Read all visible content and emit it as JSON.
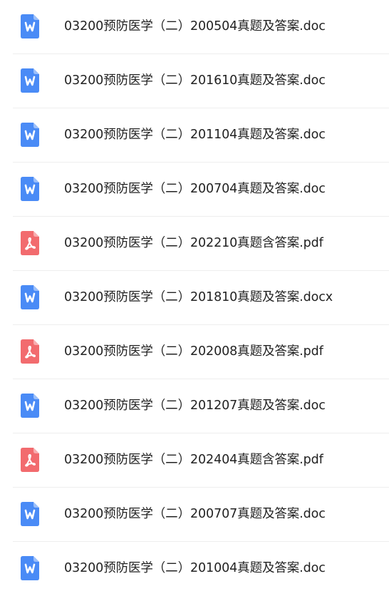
{
  "colors": {
    "word": "#4A8BF6",
    "pdf": "#F26B6E",
    "text": "#222222",
    "divider": "#EEEEEE"
  },
  "files": [
    {
      "name": "03200预防医学（二）200504真题及答案.doc",
      "type": "word",
      "icon": "word-doc-icon"
    },
    {
      "name": "03200预防医学（二）201610真题及答案.doc",
      "type": "word",
      "icon": "word-doc-icon"
    },
    {
      "name": "03200预防医学（二）201104真题及答案.doc",
      "type": "word",
      "icon": "word-doc-icon"
    },
    {
      "name": "03200预防医学（二）200704真题及答案.doc",
      "type": "word",
      "icon": "word-doc-icon"
    },
    {
      "name": "03200预防医学（二）202210真题含答案.pdf",
      "type": "pdf",
      "icon": "pdf-icon"
    },
    {
      "name": "03200预防医学（二）201810真题及答案.docx",
      "type": "word",
      "icon": "word-doc-icon"
    },
    {
      "name": "03200预防医学（二）202008真题及答案.pdf",
      "type": "pdf",
      "icon": "pdf-icon"
    },
    {
      "name": "03200预防医学（二）201207真题及答案.doc",
      "type": "word",
      "icon": "word-doc-icon"
    },
    {
      "name": "03200预防医学（二）202404真题含答案.pdf",
      "type": "pdf",
      "icon": "pdf-icon"
    },
    {
      "name": "03200预防医学（二）200707真题及答案.doc",
      "type": "word",
      "icon": "word-doc-icon"
    },
    {
      "name": "03200预防医学（二）201004真题及答案.doc",
      "type": "word",
      "icon": "word-doc-icon"
    }
  ]
}
